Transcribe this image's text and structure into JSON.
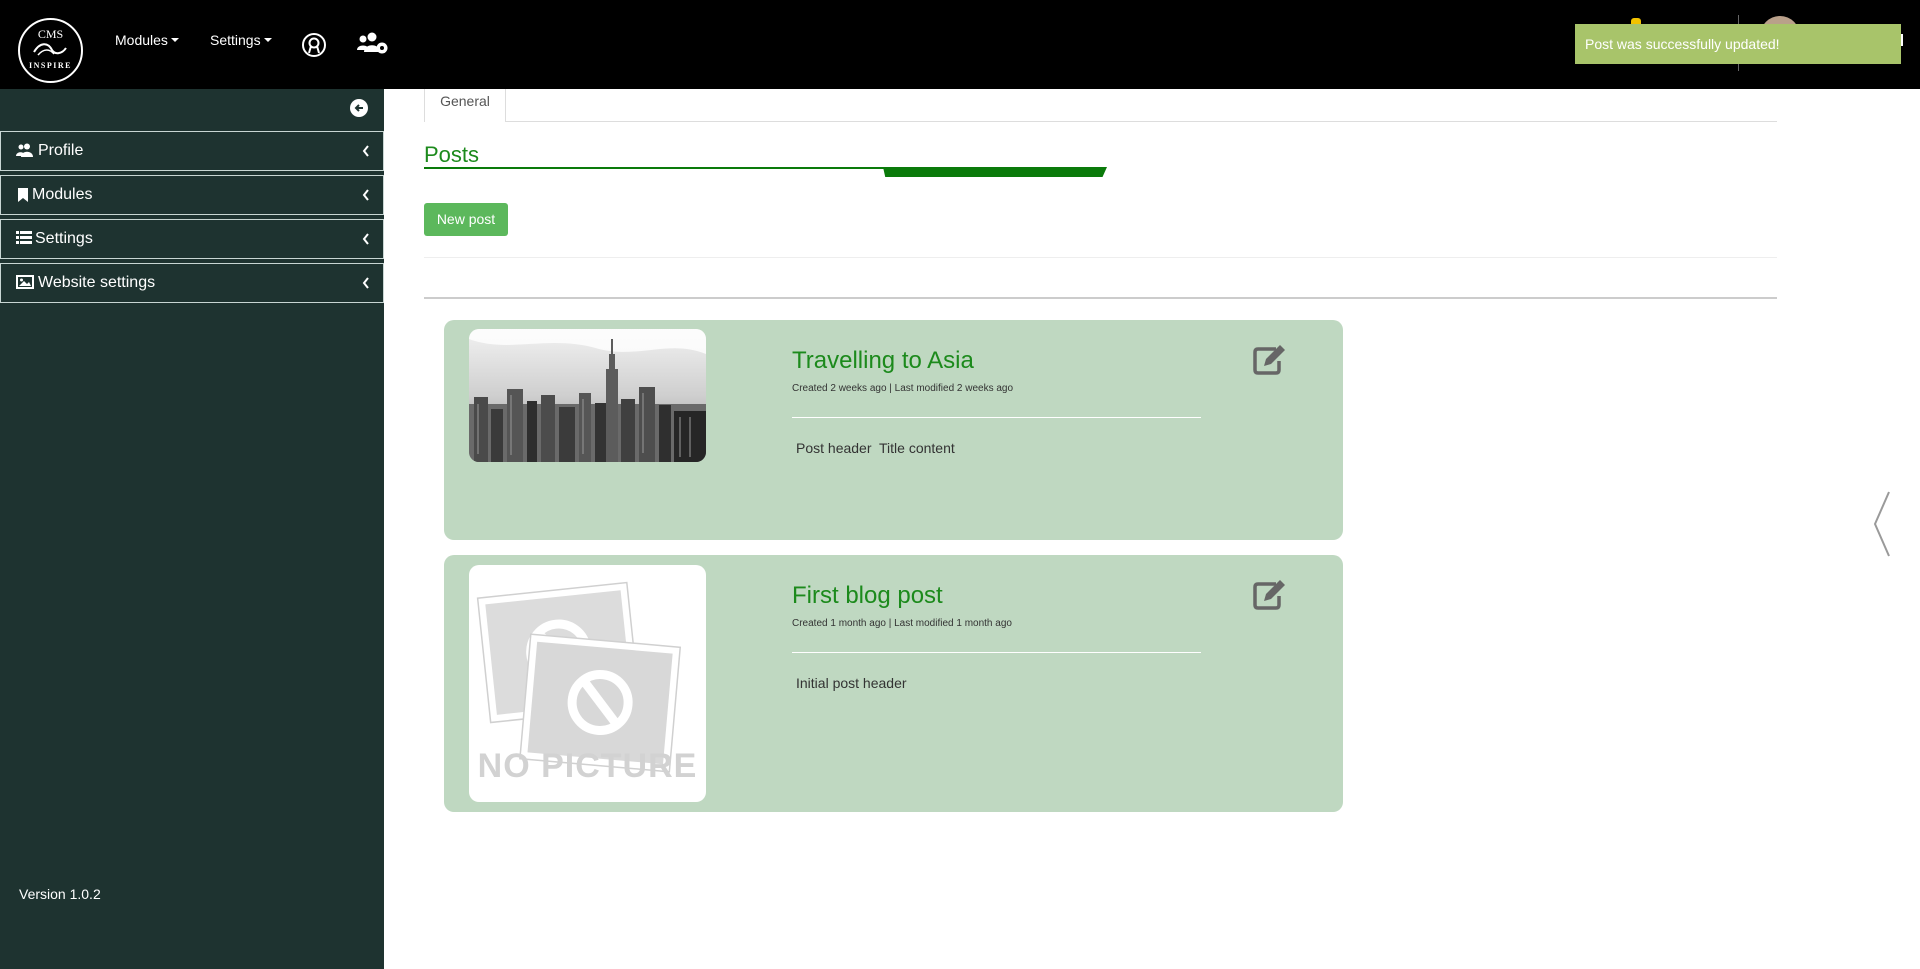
{
  "header": {
    "logo_top": "CMS",
    "logo_bottom": "INSPIRE",
    "nav": [
      {
        "label": "Modules"
      },
      {
        "label": "Settings"
      }
    ],
    "icons": [
      "support-icon",
      "users-cog-icon"
    ],
    "toast": "Post was successfully updated!"
  },
  "sidebar": {
    "items": [
      {
        "label": "Profile",
        "icon": "users-icon"
      },
      {
        "label": "Modules",
        "icon": "bookmark-icon"
      },
      {
        "label": "Settings",
        "icon": "list-icon"
      },
      {
        "label": "Website settings",
        "icon": "image-icon"
      }
    ],
    "version": "Version 1.0.2"
  },
  "main": {
    "tab": "General",
    "title": "Posts",
    "new_post_label": "New post",
    "posts": [
      {
        "title": "Travelling to Asia",
        "meta": "Created 2 weeks ago | Last modified 2 weeks ago",
        "body": "Post header  Title content",
        "image": "city-skyline-photo"
      },
      {
        "title": "First blog post",
        "meta": "Created 1 month ago | Last modified 1 month ago",
        "body": "Initial post header",
        "image": "no-picture-placeholder",
        "image_text": "NO PICTURE"
      }
    ]
  },
  "colors": {
    "topbar": "#000000",
    "sidebar": "#1e3330",
    "accent": "#1c8a1c",
    "card": "#bfd8c1",
    "button": "#5cb85c",
    "toast": "#a8c46a"
  }
}
